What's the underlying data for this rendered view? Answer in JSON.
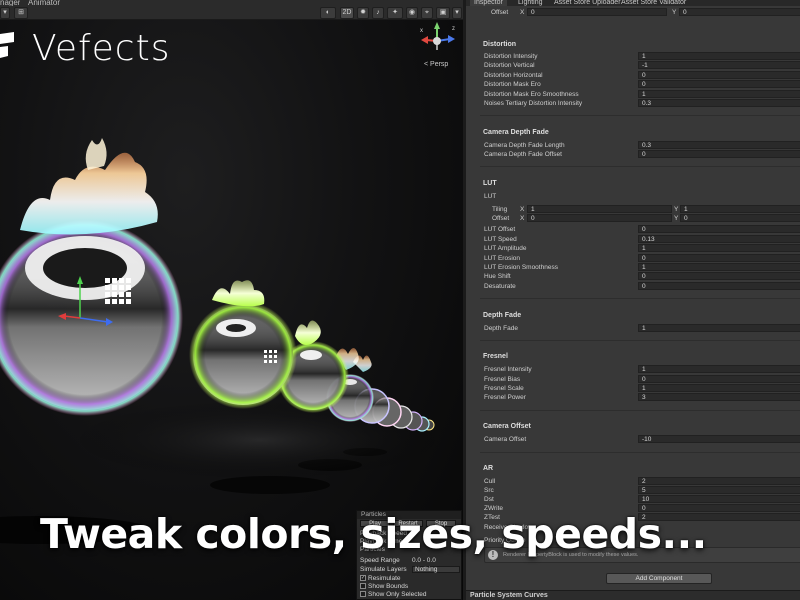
{
  "scene": {
    "tabs": [
      "nager",
      "Animator"
    ],
    "toolbar": {
      "mode_2d": "2D",
      "persp_label": "< Persp"
    },
    "logo_text": "Vefects"
  },
  "particles_panel": {
    "title": "Particles",
    "buttons": [
      "Play",
      "Restart",
      "Stop"
    ],
    "rows": [
      {
        "label": "Playback Speed",
        "value": ""
      },
      {
        "label": "Playback Time",
        "value": ""
      },
      {
        "label": "Particles",
        "value": ""
      },
      {
        "label": "Speed Range",
        "value": "0.0 - 0.0"
      }
    ],
    "simulate_layers_label": "Simulate Layers",
    "simulate_layers_value": "Nothing",
    "checks": [
      {
        "label": "Resimulate",
        "checked": true
      },
      {
        "label": "Show Bounds",
        "checked": false
      },
      {
        "label": "Show Only Selected",
        "checked": false
      }
    ]
  },
  "inspector": {
    "tabs": [
      "Inspector",
      "Lighting",
      "Asset Store Uploader",
      "Asset Store Validator"
    ],
    "offset_top": {
      "label": "Offset",
      "x": "0",
      "y": "0"
    },
    "sections": [
      {
        "title": "Distortion",
        "rows": [
          {
            "label": "Distortion Intensity",
            "value": "1"
          },
          {
            "label": "Distortion Vertical",
            "value": "-1"
          },
          {
            "label": "Distortion Horizontal",
            "value": "0"
          },
          {
            "label": "Distortion Mask Ero",
            "value": "0"
          },
          {
            "label": "Distortion Mask Ero Smoothness",
            "value": "1"
          },
          {
            "label": "Noises Tertiary Distortion Intensity",
            "value": "0.3"
          }
        ]
      },
      {
        "title": "Camera Depth Fade",
        "rows": [
          {
            "label": "Camera Depth Fade Length",
            "value": "0.3"
          },
          {
            "label": "Camera Depth Fade Offset",
            "value": "0"
          }
        ]
      },
      {
        "title": "LUT",
        "rows": [
          {
            "label": "LUT Offset",
            "value": "0"
          },
          {
            "label": "LUT Speed",
            "value": "0.13"
          },
          {
            "label": "LUT Amplitude",
            "value": "1"
          },
          {
            "label": "LUT Erosion",
            "value": "0"
          },
          {
            "label": "LUT Erosion Smoothness",
            "value": "1"
          },
          {
            "label": "Hue Shift",
            "value": "0"
          },
          {
            "label": "Desaturate",
            "value": "0"
          }
        ]
      },
      {
        "title": "Depth Fade",
        "rows": [
          {
            "label": "Depth Fade",
            "value": "1"
          }
        ]
      },
      {
        "title": "Fresnel",
        "rows": [
          {
            "label": "Fresnel Intensity",
            "value": "1"
          },
          {
            "label": "Fresnel Bias",
            "value": "0"
          },
          {
            "label": "Fresnel Scale",
            "value": "1"
          },
          {
            "label": "Fresnel Power",
            "value": "3"
          }
        ]
      },
      {
        "title": "Camera Offset",
        "rows": [
          {
            "label": "Camera Offset",
            "value": "-10"
          }
        ]
      },
      {
        "title": "AR",
        "rows": [
          {
            "label": "Cull",
            "value": "2"
          },
          {
            "label": "Src",
            "value": "5"
          },
          {
            "label": "Dst",
            "value": "10"
          },
          {
            "label": "ZWrite",
            "value": "0"
          },
          {
            "label": "ZTest",
            "value": "2"
          }
        ]
      }
    ],
    "lut_texture": {
      "label": "LUT",
      "tiling": {
        "label": "Tiling",
        "x": "1",
        "y": "1"
      },
      "offset": {
        "label": "Offset",
        "x": "0",
        "y": "0"
      }
    },
    "extra_rows": [
      "Receive Shadows",
      "Priority Queue"
    ],
    "help_text": "Renderer PropertyBlock is used to modify these values.",
    "add_component": "Add Component",
    "curves_header": "Particle System Curves"
  },
  "caption": "Tweak colors, sizes, speeds..."
}
